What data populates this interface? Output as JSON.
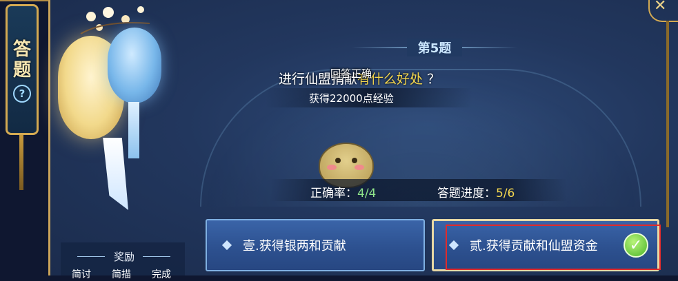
{
  "side_tab": {
    "char1": "答",
    "char2": "题",
    "help": "?"
  },
  "header": {
    "title": "第5题"
  },
  "question": {
    "prefix": "进行仙盟",
    "middle": "捐献",
    "highlight": "有什么好处",
    "suffix": "？",
    "feedback": "回答正确",
    "reward": "获得22000点经验"
  },
  "stats": {
    "accuracy_label": "正确率：",
    "accuracy_value": "4/4",
    "progress_label": "答题进度：",
    "progress_value": "5/6"
  },
  "options": [
    {
      "label": "壹.获得银两和贡献"
    },
    {
      "label": "贰.获得贡献和仙盟资金"
    }
  ],
  "reward_panel": {
    "label": "奖励",
    "tabs": [
      "简讨",
      "简描",
      "完成"
    ]
  },
  "colors": {
    "highlight_text": "#f3d64f",
    "correct_value": "#8ee38a",
    "selection_box": "#e22a2a",
    "frame_gold": "#d4aa52"
  },
  "icons": {
    "check": "check-circle-icon",
    "help": "question-circle-icon",
    "close": "close-icon"
  }
}
